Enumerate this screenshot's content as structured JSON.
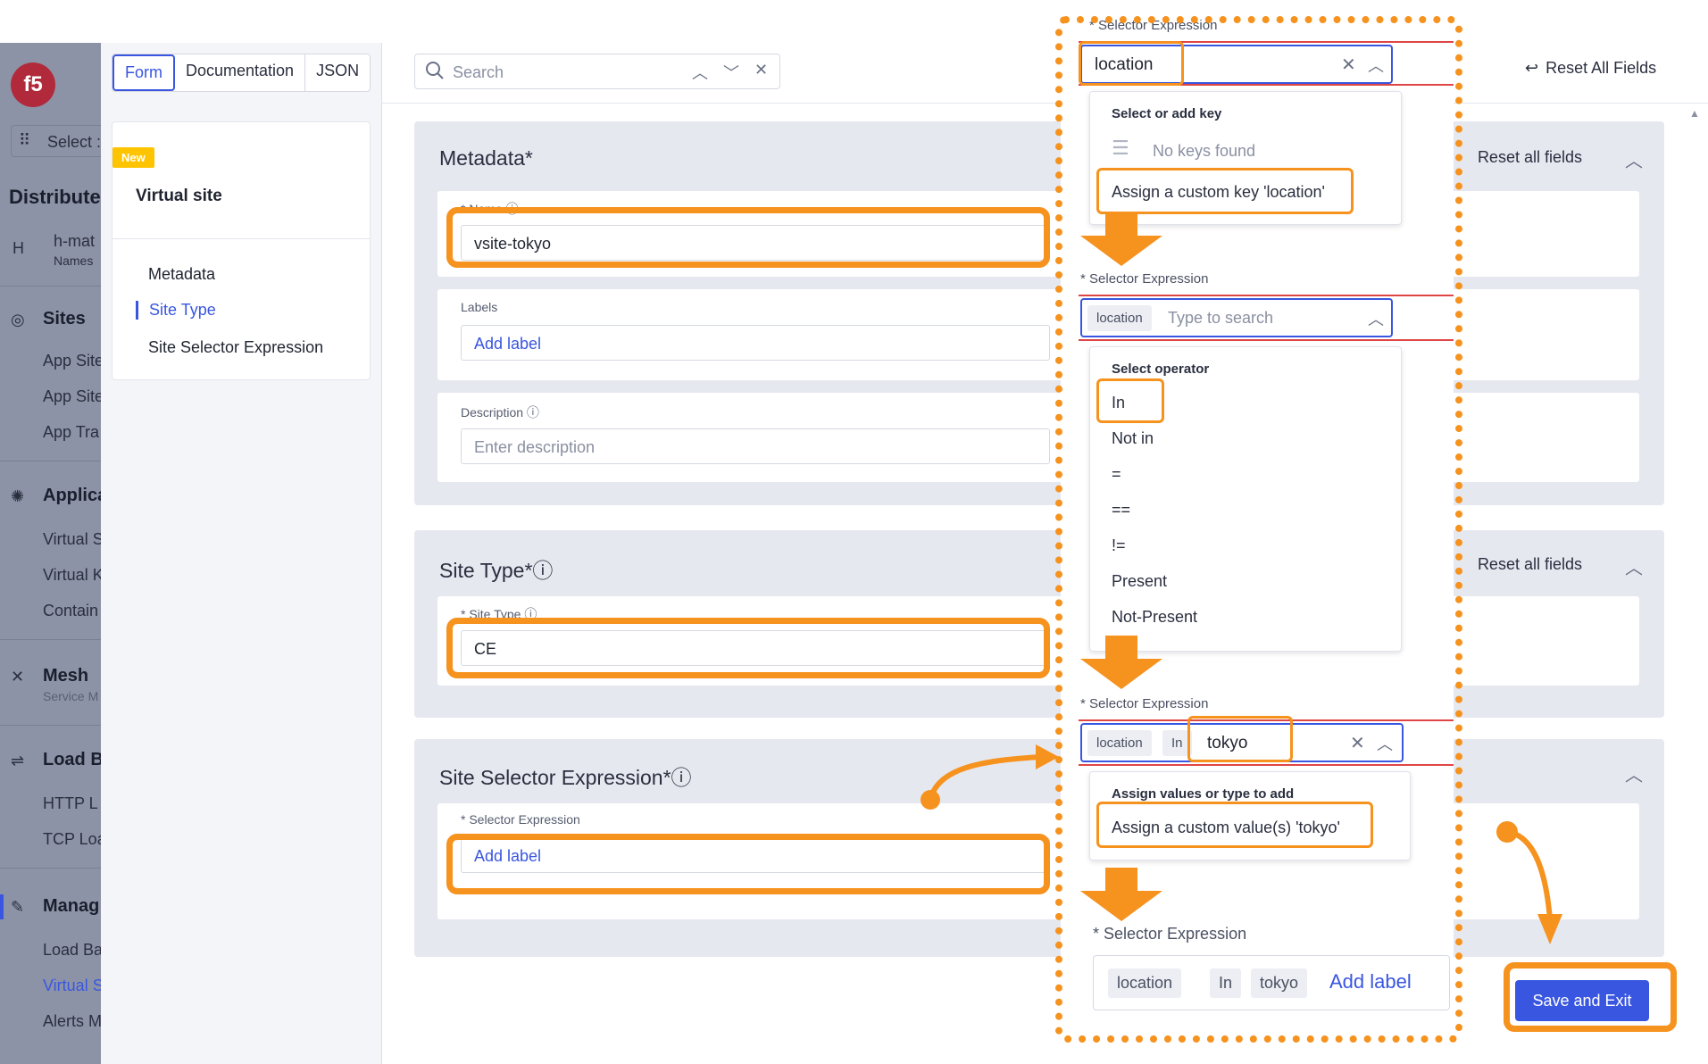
{
  "left_nav": {
    "select_label": "Select :",
    "heading": "Distribute",
    "namespace_initial": "H",
    "namespace_name": "h-mat",
    "namespace_sub": "Names",
    "sections": [
      {
        "label": "Sites",
        "items": [
          "App Site",
          "App Site",
          "App Tra"
        ]
      },
      {
        "label": "Applica",
        "items": [
          "Virtual S",
          "Virtual K",
          "Contain"
        ]
      },
      {
        "label": "Mesh",
        "sub": "Service M"
      },
      {
        "label": "Load B",
        "items": [
          "HTTP L",
          "TCP Loa"
        ]
      },
      {
        "label": "Manag",
        "items": [
          "Load Ba",
          "Virtual S",
          "Alerts M"
        ]
      }
    ]
  },
  "tabs": [
    "Form",
    "Documentation",
    "JSON"
  ],
  "toc": {
    "badge": "New",
    "title": "Virtual site",
    "links": [
      "Metadata",
      "Site Type",
      "Site Selector Expression"
    ]
  },
  "search": {
    "placeholder": "Search"
  },
  "header": {
    "reset_all": "Reset All Fields"
  },
  "metadata": {
    "title": "Metadata",
    "reset": "Reset all fields",
    "name_label": "Name",
    "name_value": "vsite-tokyo",
    "labels_label": "Labels",
    "labels_add": "Add label",
    "desc_label": "Description",
    "desc_placeholder": "Enter description"
  },
  "site_type": {
    "title": "Site Type",
    "reset": "Reset all fields",
    "field_label": "Site Type",
    "value": "CE"
  },
  "site_selector": {
    "title": "Site Selector Expression",
    "field_label": "Selector Expression",
    "add": "Add label"
  },
  "zoom": {
    "step1": {
      "label": "Selector Expression",
      "input": "location",
      "dd_header": "Select or add key",
      "no_keys": "No keys found",
      "custom": "Assign a custom key 'location'"
    },
    "step2": {
      "label": "Selector Expression",
      "chip": "location",
      "placeholder": "Type to search",
      "dd_header": "Select operator",
      "ops": [
        "In",
        "Not in",
        "=",
        "==",
        "!=",
        "Present",
        "Not-Present"
      ]
    },
    "step3": {
      "label": "Selector Expression",
      "chip_key": "location",
      "chip_op": "In",
      "input": "tokyo",
      "dd_header": "Assign values or type to add",
      "custom": "Assign a custom value(s) 'tokyo'"
    },
    "step4": {
      "label": "Selector Expression",
      "chips": [
        "location",
        "In",
        "tokyo"
      ],
      "add": "Add label"
    }
  },
  "save_button": "Save and Exit",
  "colors": {
    "accent": "#3956e0",
    "annotation": "#f6921e"
  }
}
